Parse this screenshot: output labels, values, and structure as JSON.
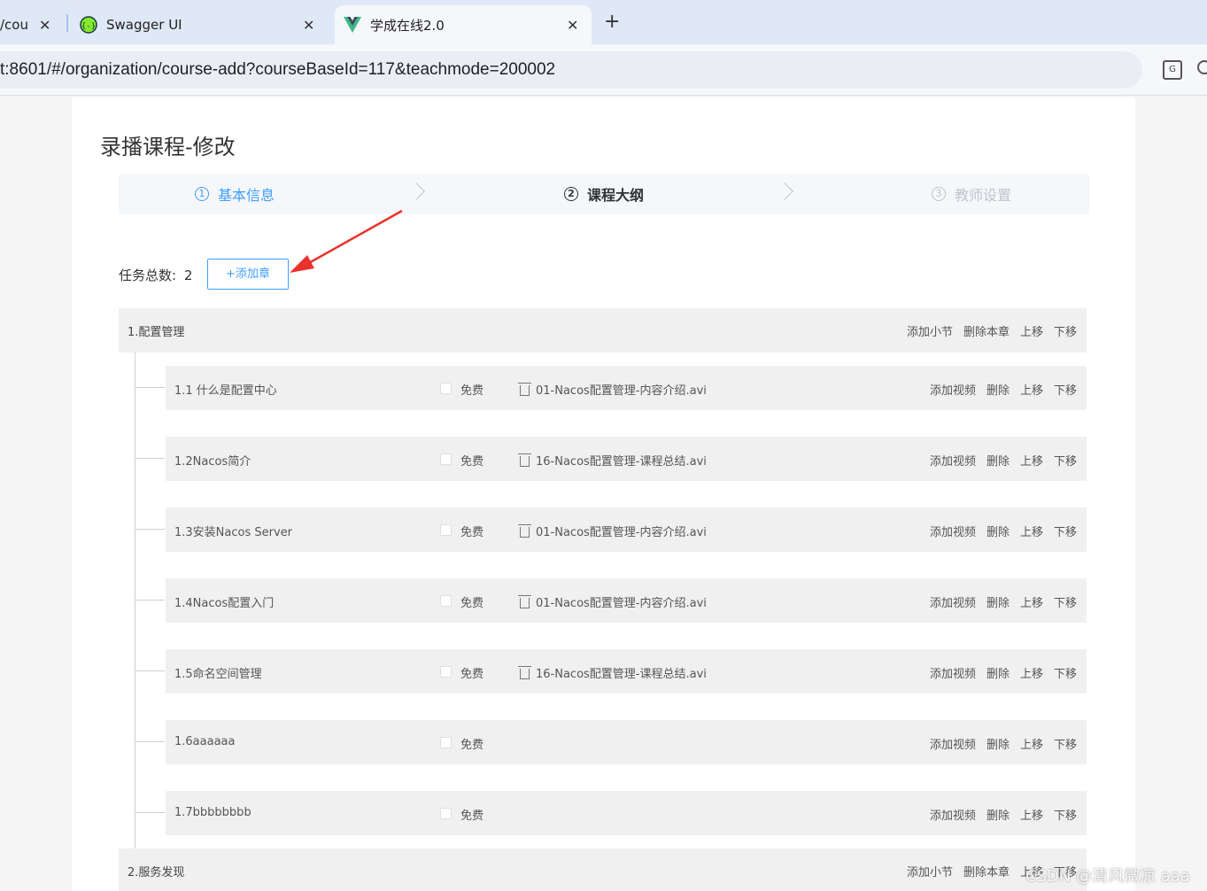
{
  "browser": {
    "tabs": [
      {
        "label": "/cou",
        "icon": "page-icon"
      },
      {
        "label": "Swagger UI",
        "icon": "swagger-icon"
      },
      {
        "label": "学成在线2.0",
        "icon": "vue-icon",
        "active": true
      }
    ],
    "new_tab_symbol": "+",
    "close_symbol": "✕",
    "url": "t:8601/#/organization/course-add?courseBaseId=117&teachmode=200002"
  },
  "page": {
    "title": "录播课程-修改",
    "steps": [
      {
        "num": "1",
        "label": "基本信息",
        "state": "done"
      },
      {
        "num": "2",
        "label": "课程大纲",
        "state": "current"
      },
      {
        "num": "3",
        "label": "教师设置",
        "state": "wait"
      }
    ],
    "task_count_label": "任务总数:",
    "task_count": "2",
    "add_chapter_label": "+添加章",
    "chapter_ops": [
      "添加小节",
      "删除本章",
      "上移",
      "下移"
    ],
    "section_ops": [
      "添加视频",
      "删除",
      "上移",
      "下移"
    ],
    "free_label": "免费",
    "chapters": [
      {
        "title": "1.配置管理",
        "sections": [
          {
            "title": "1.1 什么是配置中心",
            "media": "01-Nacos配置管理-内容介绍.avi"
          },
          {
            "title": "1.2Nacos简介",
            "media": "16-Nacos配置管理-课程总结.avi"
          },
          {
            "title": "1.3安装Nacos Server",
            "media": "01-Nacos配置管理-内容介绍.avi"
          },
          {
            "title": "1.4Nacos配置入门",
            "media": "01-Nacos配置管理-内容介绍.avi"
          },
          {
            "title": "1.5命名空间管理",
            "media": "16-Nacos配置管理-课程总结.avi"
          },
          {
            "title": "1.6aaaaaa",
            "media": ""
          },
          {
            "title": "1.7bbbbbbbb",
            "media": ""
          }
        ]
      },
      {
        "title": "2.服务发现",
        "sections": []
      }
    ]
  },
  "watermark": "CSDN @清风微凉 aaa",
  "colors": {
    "accent": "#409eff",
    "annotation_arrow": "#e8322b"
  }
}
